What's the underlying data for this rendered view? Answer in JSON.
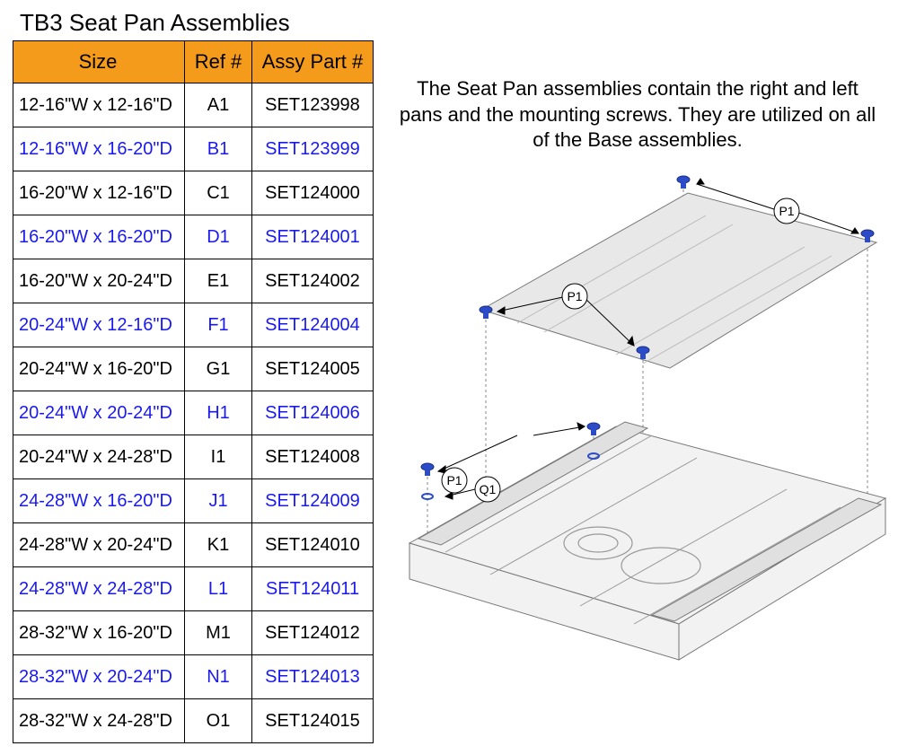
{
  "title": "TB3 Seat Pan Assemblies",
  "headers": {
    "size": "Size",
    "ref": "Ref #",
    "part": "Assy Part #"
  },
  "rows": [
    {
      "size": "12-16\"W x 12-16\"D",
      "ref": "A1",
      "part": "SET123998",
      "blue": false
    },
    {
      "size": "12-16\"W x 16-20\"D",
      "ref": "B1",
      "part": "SET123999",
      "blue": true
    },
    {
      "size": "16-20\"W x 12-16\"D",
      "ref": "C1",
      "part": "SET124000",
      "blue": false
    },
    {
      "size": "16-20\"W x 16-20\"D",
      "ref": "D1",
      "part": "SET124001",
      "blue": true
    },
    {
      "size": "16-20\"W x 20-24\"D",
      "ref": "E1",
      "part": "SET124002",
      "blue": false
    },
    {
      "size": "20-24\"W x 12-16\"D",
      "ref": "F1",
      "part": "SET124004",
      "blue": true
    },
    {
      "size": "20-24\"W x 16-20\"D",
      "ref": "G1",
      "part": "SET124005",
      "blue": false
    },
    {
      "size": "20-24\"W x 20-24\"D",
      "ref": "H1",
      "part": "SET124006",
      "blue": true
    },
    {
      "size": "20-24\"W x 24-28\"D",
      "ref": "I1",
      "part": "SET124008",
      "blue": false
    },
    {
      "size": "24-28\"W x 16-20\"D",
      "ref": "J1",
      "part": "SET124009",
      "blue": true
    },
    {
      "size": "24-28\"W x 20-24\"D",
      "ref": "K1",
      "part": "SET124010",
      "blue": false
    },
    {
      "size": "24-28\"W x 24-28\"D",
      "ref": "L1",
      "part": "SET124011",
      "blue": true
    },
    {
      "size": "28-32\"W x 16-20\"D",
      "ref": "M1",
      "part": "SET124012",
      "blue": false
    },
    {
      "size": "28-32\"W x 20-24\"D",
      "ref": "N1",
      "part": "SET124013",
      "blue": true
    },
    {
      "size": "28-32\"W x 24-28\"D",
      "ref": "O1",
      "part": "SET124015",
      "blue": false
    }
  ],
  "description": "The Seat Pan assemblies contain the right and left pans and the mounting screws. They are utilized on all of the Base assemblies.",
  "callouts": {
    "p1": "P1",
    "q1": "Q1"
  }
}
